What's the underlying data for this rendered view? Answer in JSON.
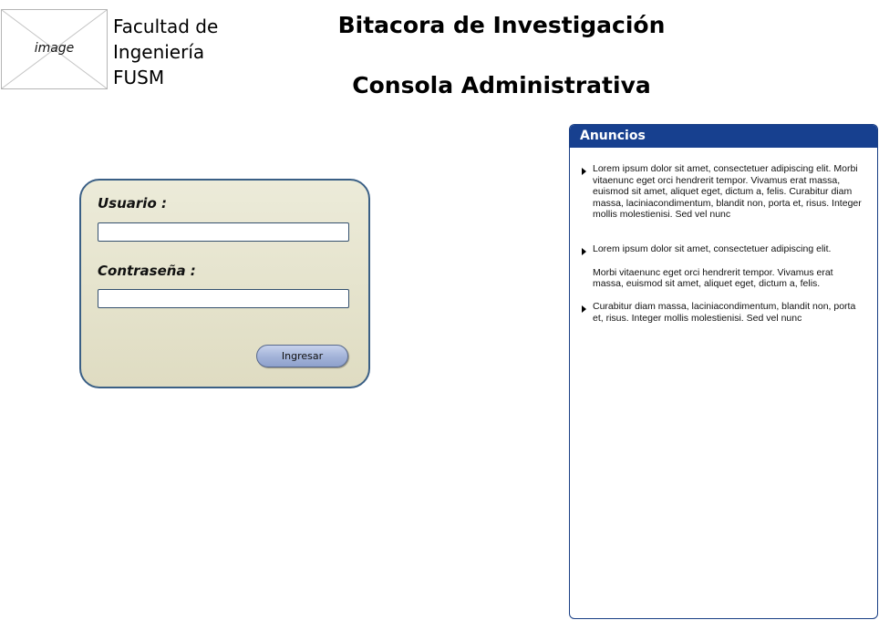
{
  "header": {
    "logo_label": "image",
    "faculty_lines": [
      "Facultad de",
      "Ingeniería",
      "FUSM"
    ],
    "title": "Bitacora de Investigación",
    "subtitle": "Consola Administrativa"
  },
  "login": {
    "username_label": "Usuario :",
    "username_value": "",
    "password_label": "Contraseña :",
    "password_value": "",
    "submit_label": "Ingresar"
  },
  "announcements": {
    "title": "Anuncios",
    "items": [
      {
        "paragraphs": [
          "Lorem ipsum dolor sit amet, consectetuer adipiscing elit. Morbi vitaenunc eget orci hendrerit tempor. Vivamus erat massa, euismod sit amet, aliquet eget, dictum a, felis. Curabitur diam massa, laciniacondimentum, blandit non, porta et, risus. Integer mollis molestienisi. Sed vel nunc"
        ]
      },
      {
        "paragraphs": [
          "Lorem ipsum dolor sit amet, consectetuer adipiscing elit.",
          "Morbi vitaenunc eget orci hendrerit tempor. Vivamus erat massa, euismod sit amet, aliquet eget, dictum a, felis."
        ]
      },
      {
        "paragraphs": [
          "Curabitur diam massa, laciniacondimentum, blandit non, porta et, risus. Integer mollis molestienisi. Sed vel nunc"
        ]
      }
    ]
  },
  "colors": {
    "announcement_header_bg": "#17408f",
    "login_panel_border": "#3a5f85",
    "login_panel_bg": "#e6e4cc",
    "button_bg": "#a2b2d8"
  }
}
